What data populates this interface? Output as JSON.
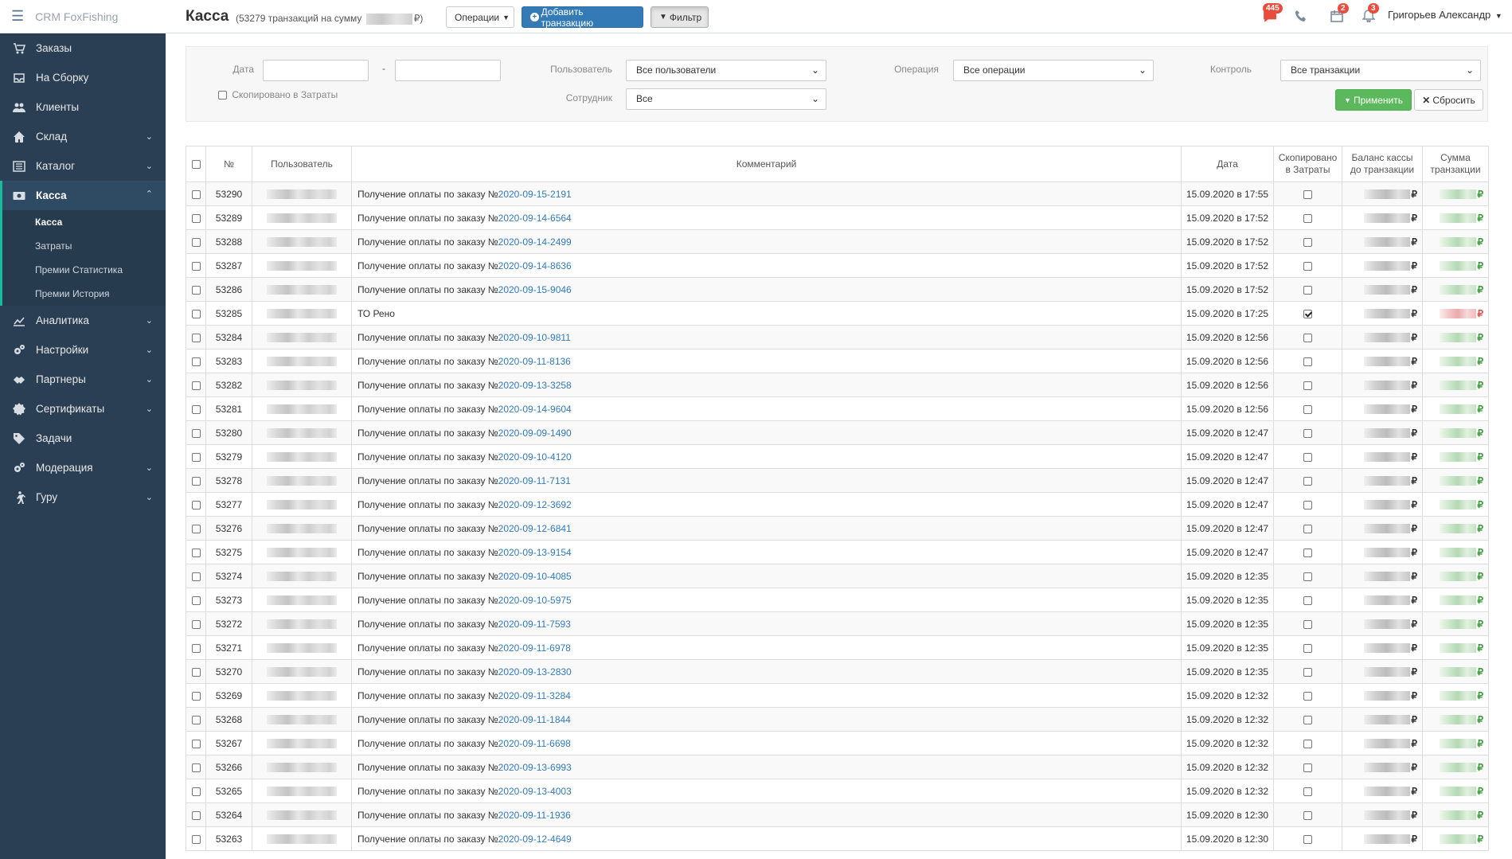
{
  "app": {
    "brand": "CRM FoxFishing"
  },
  "sidebar": {
    "items": [
      {
        "label": "Заказы",
        "icon": "cart-icon"
      },
      {
        "label": "На Сборку",
        "icon": "inbox-icon"
      },
      {
        "label": "Клиенты",
        "icon": "users-icon"
      },
      {
        "label": "Склад",
        "icon": "home-icon"
      },
      {
        "label": "Каталог",
        "icon": "list-icon"
      },
      {
        "label": "Касса",
        "icon": "money-icon"
      },
      {
        "label": "Аналитика",
        "icon": "chart-icon"
      },
      {
        "label": "Настройки",
        "icon": "gears-icon"
      },
      {
        "label": "Партнеры",
        "icon": "handshake-icon"
      },
      {
        "label": "Сертификаты",
        "icon": "certificate-icon"
      },
      {
        "label": "Задачи",
        "icon": "tag-icon"
      },
      {
        "label": "Модерация",
        "icon": "gears-icon"
      },
      {
        "label": "Гуру",
        "icon": "walker-icon"
      }
    ],
    "kassa_sub": [
      "Касса",
      "Затраты",
      "Премии Статистика",
      "Премии История"
    ]
  },
  "header": {
    "title": "Касса",
    "subtitle_prefix": "(53279 транзакций на сумму",
    "subtitle_suffix": "₽)",
    "ops_button": "Операции",
    "add_button": "Добавить транзакцию",
    "filter_button": "Фильтр",
    "msg_count": "445",
    "cal_count": "2",
    "bell_count": "3",
    "user_name": "Григорьев Александр"
  },
  "filter": {
    "date_label": "Дата",
    "date_sep": "-",
    "copied_label": "Скопировано в Затраты",
    "user_label": "Пользователь",
    "user_value": "Все пользователи",
    "employee_label": "Сотрудник",
    "employee_value": "Все",
    "op_label": "Операция",
    "op_value": "Все операции",
    "control_label": "Контроль",
    "control_value": "Все транзакции",
    "apply": "Применить",
    "reset": "Сбросить"
  },
  "table": {
    "headers": {
      "num": "№",
      "user": "Пользователь",
      "comment": "Комментарий",
      "date": "Дата",
      "copied1": "Скопировано",
      "copied2": "в Затраты",
      "balance1": "Баланс кассы",
      "balance2": "до транзакции",
      "sum1": "Сумма",
      "sum2": "транзакции"
    },
    "currency": "₽",
    "rows": [
      {
        "id": "53290",
        "prefix": "Получение оплаты по заказу №",
        "order": "2020-09-15-2191",
        "date": "15.09.2020 в 17:55",
        "copied": false,
        "sign": "pos"
      },
      {
        "id": "53289",
        "prefix": "Получение оплаты по заказу №",
        "order": "2020-09-14-6564",
        "date": "15.09.2020 в 17:52",
        "copied": false,
        "sign": "pos"
      },
      {
        "id": "53288",
        "prefix": "Получение оплаты по заказу №",
        "order": "2020-09-14-2499",
        "date": "15.09.2020 в 17:52",
        "copied": false,
        "sign": "pos"
      },
      {
        "id": "53287",
        "prefix": "Получение оплаты по заказу №",
        "order": "2020-09-14-8636",
        "date": "15.09.2020 в 17:52",
        "copied": false,
        "sign": "pos"
      },
      {
        "id": "53286",
        "prefix": "Получение оплаты по заказу №",
        "order": "2020-09-15-9046",
        "date": "15.09.2020 в 17:52",
        "copied": false,
        "sign": "pos"
      },
      {
        "id": "53285",
        "prefix": "ТО Рено",
        "order": "",
        "date": "15.09.2020 в 17:25",
        "copied": true,
        "sign": "neg"
      },
      {
        "id": "53284",
        "prefix": "Получение оплаты по заказу №",
        "order": "2020-09-10-9811",
        "date": "15.09.2020 в 12:56",
        "copied": false,
        "sign": "pos"
      },
      {
        "id": "53283",
        "prefix": "Получение оплаты по заказу №",
        "order": "2020-09-11-8136",
        "date": "15.09.2020 в 12:56",
        "copied": false,
        "sign": "pos"
      },
      {
        "id": "53282",
        "prefix": "Получение оплаты по заказу №",
        "order": "2020-09-13-3258",
        "date": "15.09.2020 в 12:56",
        "copied": false,
        "sign": "pos"
      },
      {
        "id": "53281",
        "prefix": "Получение оплаты по заказу №",
        "order": "2020-09-14-9604",
        "date": "15.09.2020 в 12:56",
        "copied": false,
        "sign": "pos"
      },
      {
        "id": "53280",
        "prefix": "Получение оплаты по заказу №",
        "order": "2020-09-09-1490",
        "date": "15.09.2020 в 12:47",
        "copied": false,
        "sign": "pos"
      },
      {
        "id": "53279",
        "prefix": "Получение оплаты по заказу №",
        "order": "2020-09-10-4120",
        "date": "15.09.2020 в 12:47",
        "copied": false,
        "sign": "pos"
      },
      {
        "id": "53278",
        "prefix": "Получение оплаты по заказу №",
        "order": "2020-09-11-7131",
        "date": "15.09.2020 в 12:47",
        "copied": false,
        "sign": "pos"
      },
      {
        "id": "53277",
        "prefix": "Получение оплаты по заказу №",
        "order": "2020-09-12-3692",
        "date": "15.09.2020 в 12:47",
        "copied": false,
        "sign": "pos"
      },
      {
        "id": "53276",
        "prefix": "Получение оплаты по заказу №",
        "order": "2020-09-12-6841",
        "date": "15.09.2020 в 12:47",
        "copied": false,
        "sign": "pos"
      },
      {
        "id": "53275",
        "prefix": "Получение оплаты по заказу №",
        "order": "2020-09-13-9154",
        "date": "15.09.2020 в 12:47",
        "copied": false,
        "sign": "pos"
      },
      {
        "id": "53274",
        "prefix": "Получение оплаты по заказу №",
        "order": "2020-09-10-4085",
        "date": "15.09.2020 в 12:35",
        "copied": false,
        "sign": "pos"
      },
      {
        "id": "53273",
        "prefix": "Получение оплаты по заказу №",
        "order": "2020-09-10-5975",
        "date": "15.09.2020 в 12:35",
        "copied": false,
        "sign": "pos"
      },
      {
        "id": "53272",
        "prefix": "Получение оплаты по заказу №",
        "order": "2020-09-11-7593",
        "date": "15.09.2020 в 12:35",
        "copied": false,
        "sign": "pos"
      },
      {
        "id": "53271",
        "prefix": "Получение оплаты по заказу №",
        "order": "2020-09-11-6978",
        "date": "15.09.2020 в 12:35",
        "copied": false,
        "sign": "pos"
      },
      {
        "id": "53270",
        "prefix": "Получение оплаты по заказу №",
        "order": "2020-09-13-2830",
        "date": "15.09.2020 в 12:35",
        "copied": false,
        "sign": "pos"
      },
      {
        "id": "53269",
        "prefix": "Получение оплаты по заказу №",
        "order": "2020-09-11-3284",
        "date": "15.09.2020 в 12:32",
        "copied": false,
        "sign": "pos"
      },
      {
        "id": "53268",
        "prefix": "Получение оплаты по заказу №",
        "order": "2020-09-11-1844",
        "date": "15.09.2020 в 12:32",
        "copied": false,
        "sign": "pos"
      },
      {
        "id": "53267",
        "prefix": "Получение оплаты по заказу №",
        "order": "2020-09-11-6698",
        "date": "15.09.2020 в 12:32",
        "copied": false,
        "sign": "pos"
      },
      {
        "id": "53266",
        "prefix": "Получение оплаты по заказу №",
        "order": "2020-09-13-6993",
        "date": "15.09.2020 в 12:32",
        "copied": false,
        "sign": "pos"
      },
      {
        "id": "53265",
        "prefix": "Получение оплаты по заказу №",
        "order": "2020-09-13-4003",
        "date": "15.09.2020 в 12:32",
        "copied": false,
        "sign": "pos"
      },
      {
        "id": "53264",
        "prefix": "Получение оплаты по заказу №",
        "order": "2020-09-11-1936",
        "date": "15.09.2020 в 12:30",
        "copied": false,
        "sign": "pos"
      },
      {
        "id": "53263",
        "prefix": "Получение оплаты по заказу №",
        "order": "2020-09-12-4649",
        "date": "15.09.2020 в 12:30",
        "copied": false,
        "sign": "pos"
      }
    ]
  }
}
